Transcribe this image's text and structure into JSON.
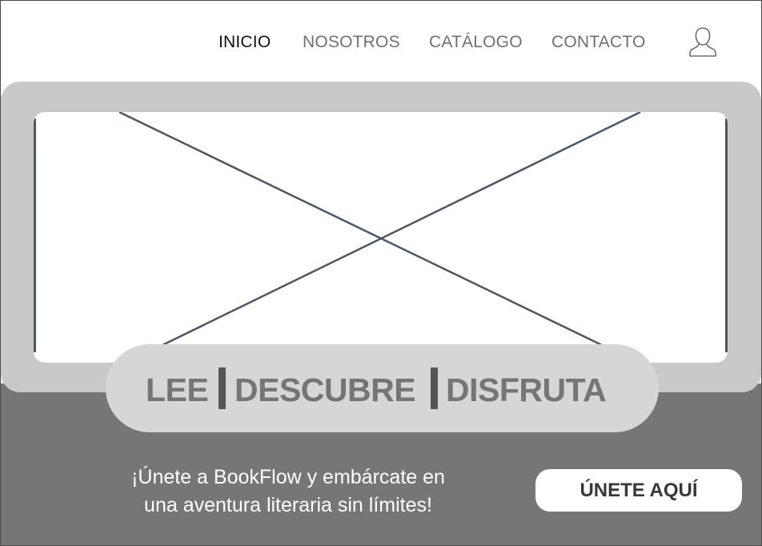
{
  "nav": {
    "items": [
      {
        "label": "INICIO",
        "active": true
      },
      {
        "label": "NOSOTROS",
        "active": false
      },
      {
        "label": "CATÁLOGO",
        "active": false
      },
      {
        "label": "CONTACTO",
        "active": false
      }
    ],
    "user_icon": "user-icon"
  },
  "hero": {
    "image_icon": "image-placeholder-icon",
    "tagline": {
      "words": [
        "LEE",
        "DESCUBRE",
        "DISFRUTA"
      ]
    },
    "cta": {
      "text_lines": [
        "¡Únete a BookFlow y embárcate en",
        "una aventura literaria sin límites!"
      ],
      "button_label": "ÚNETE AQUÍ"
    }
  },
  "colors": {
    "nav_text": "#6f6f76",
    "nav_active": "#111111",
    "hero_frame": "#c9c9c9",
    "hero_bottom": "#767676",
    "tagline_pill": "#d6d6d6",
    "tagline_text": "#757575",
    "button_text": "#383838"
  }
}
